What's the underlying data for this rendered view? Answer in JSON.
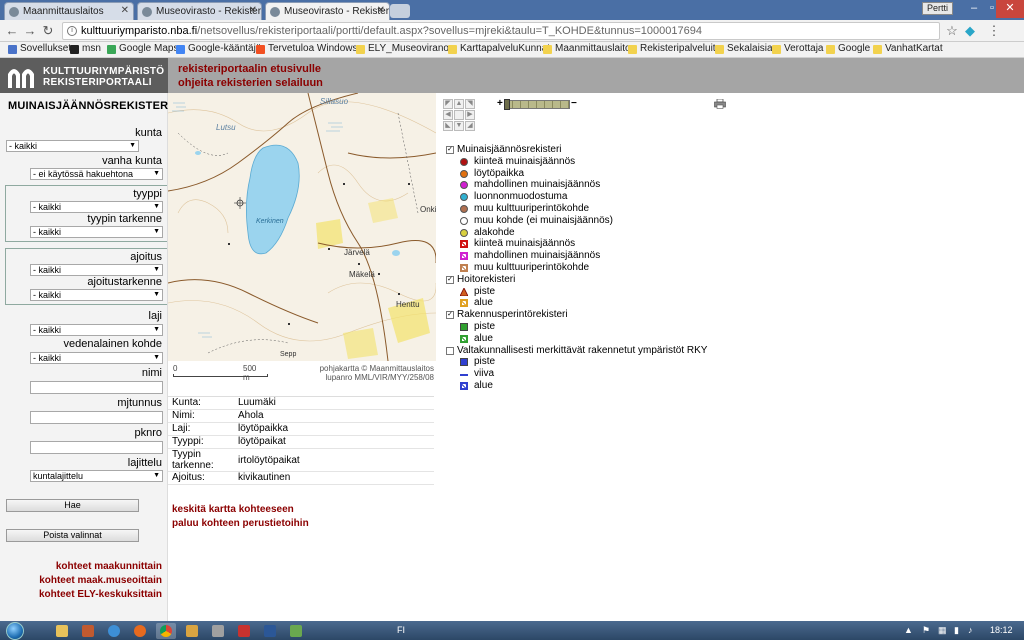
{
  "browser": {
    "tabs": [
      {
        "title": "Maanmittauslaitos",
        "active": false
      },
      {
        "title": "Museovirasto - Rekister",
        "active": false
      },
      {
        "title": "Museovirasto - Rekisteri",
        "active": true
      }
    ],
    "user_label": "Pertti",
    "url_host": "kulttuuriymparisto.nba.fi",
    "url_path": "/netsovellus/rekisteriportaali/portti/default.aspx?sovellus=mjreki&taulu=T_KOHDE&tunnus=1000017694",
    "bookmarks": [
      {
        "label": "Sovellukset",
        "color": "#4a73c9"
      },
      {
        "label": "msn",
        "color": "#222222"
      },
      {
        "label": "Google Maps",
        "color": "#3aa757"
      },
      {
        "label": "Google-kääntäjä",
        "color": "#4285f4"
      },
      {
        "label": "Tervetuloa Windows",
        "color": "#f25022"
      },
      {
        "label": "ELY_Museoviranom",
        "color": "#f2d24e"
      },
      {
        "label": "KarttapalveluKunnat",
        "color": "#f2d24e"
      },
      {
        "label": "Maanmittauslaitos",
        "color": "#f2d24e"
      },
      {
        "label": "Rekisteripalveluita",
        "color": "#f2d24e"
      },
      {
        "label": "Sekalaisia",
        "color": "#f2d24e"
      },
      {
        "label": "Verottaja",
        "color": "#f2d24e"
      },
      {
        "label": "Google",
        "color": "#f2d24e"
      },
      {
        "label": "VanhatKartat",
        "color": "#f2d24e"
      }
    ]
  },
  "header": {
    "logo_line1": "KULTTUURIYMPÄRISTÖ",
    "logo_line2": "REKISTERIPORTAALI",
    "link_home": "rekisteriportaalin etusivulle",
    "link_help": "ohjeita rekisterien selailuun"
  },
  "sidebar": {
    "title": "MUINAISJÄÄNNÖSREKISTERI",
    "kunta_label": "kunta",
    "kunta_value": "- kaikki",
    "vanha_kunta_label": "vanha kunta",
    "vanha_kunta_value": "- ei käytössä hakuehtona",
    "tyyppi_label": "tyyppi",
    "tyyppi_value": "- kaikki",
    "tyypin_tarkenne_label": "tyypin tarkenne",
    "tyypin_tarkenne_value": "- kaikki",
    "ajoitus_label": "ajoitus",
    "ajoitus_value": "- kaikki",
    "ajoitustarkenne_label": "ajoitustarkenne",
    "ajoitustarkenne_value": "- kaikki",
    "laji_label": "laji",
    "laji_value": "- kaikki",
    "vedenalainen_label": "vedenalainen kohde",
    "vedenalainen_value": "- kaikki",
    "nimi_label": "nimi",
    "mjtunnus_label": "mjtunnus",
    "pknro_label": "pknro",
    "lajittelu_label": "lajittelu",
    "lajittelu_value": "kuntalajittelu",
    "search_button": "Hae",
    "clear_button": "Poista valinnat",
    "link_maakunnittain": "kohteet maakunnittain",
    "link_museoittain": "kohteet maak.museoittain",
    "link_ely": "kohteet ELY-keskuksittain"
  },
  "map": {
    "labels": [
      "Sillasuo",
      "Lutsu",
      "Kerkinen",
      "Järvelä",
      "Mäkelä",
      "Henttu",
      "Onki",
      "Sepp"
    ],
    "scale_start": "0",
    "scale_end": "500 m",
    "attribution1": "pohjakartta © Maanmittauslaitos",
    "attribution2": "lupanro MML/VIR/MYY/258/08"
  },
  "info": {
    "rows": [
      {
        "key": "Kunta:",
        "value": "Luumäki"
      },
      {
        "key": "Nimi:",
        "value": "Ahola"
      },
      {
        "key": "Laji:",
        "value": "löytöpaikka"
      },
      {
        "key": "Tyyppi:",
        "value": "löytöpaikat"
      },
      {
        "key": "Tyypin tarkenne:",
        "value": "irtolöytöpaikat"
      },
      {
        "key": "Ajoitus:",
        "value": "kivikautinen"
      }
    ],
    "link_center": "keskitä kartta kohteeseen",
    "link_back": "paluu kohteen perustietoihin"
  },
  "legend": {
    "muinais": {
      "label": "Muinaisjäännösrekisteri",
      "checked": true,
      "items": [
        {
          "label": "kiinteä muinaisjäännös",
          "icon": "dot",
          "color": "#b01010"
        },
        {
          "label": "löytöpaikka",
          "icon": "dot",
          "color": "#e07010"
        },
        {
          "label": "mahdollinen muinaisjäännös",
          "icon": "dot",
          "color": "#d020d0"
        },
        {
          "label": "luonnonmuodostuma",
          "icon": "dot",
          "color": "#30b0d0"
        },
        {
          "label": "muu kulttuuriperintökohde",
          "icon": "dot",
          "color": "#b07050"
        },
        {
          "label": "muu kohde (ei muinaisjäännös)",
          "icon": "dot",
          "color": "#ffffff"
        },
        {
          "label": "alakohde",
          "icon": "dot",
          "color": "#d8d040"
        },
        {
          "label": "kiinteä muinaisjäännös",
          "icon": "hatch",
          "color": "#d01010"
        },
        {
          "label": "mahdollinen muinaisjäännös",
          "icon": "hatch",
          "color": "#d020d0"
        },
        {
          "label": "muu kulttuuriperintökohde",
          "icon": "hatch",
          "color": "#c08050"
        }
      ]
    },
    "hoito": {
      "label": "Hoitorekisteri",
      "checked": true,
      "items": [
        {
          "label": "piste",
          "icon": "triangle",
          "color": "#d06020"
        },
        {
          "label": "alue",
          "icon": "hatch",
          "color": "#e0a020"
        }
      ]
    },
    "rakennus": {
      "label": "Rakennusperintörekisteri",
      "checked": true,
      "items": [
        {
          "label": "piste",
          "icon": "square",
          "color": "#30a030"
        },
        {
          "label": "alue",
          "icon": "hatch",
          "color": "#30a030"
        }
      ]
    },
    "rky": {
      "label": "Valtakunnallisesti merkittävät rakennetut ympäristöt RKY",
      "checked": false,
      "items": [
        {
          "label": "piste",
          "icon": "square",
          "color": "#3040d0"
        },
        {
          "label": "viiva",
          "icon": "line",
          "color": "#3040d0"
        },
        {
          "label": "alue",
          "icon": "hatch",
          "color": "#3040d0"
        }
      ]
    }
  },
  "taskbar": {
    "lang": "FI",
    "time": "18:12"
  }
}
